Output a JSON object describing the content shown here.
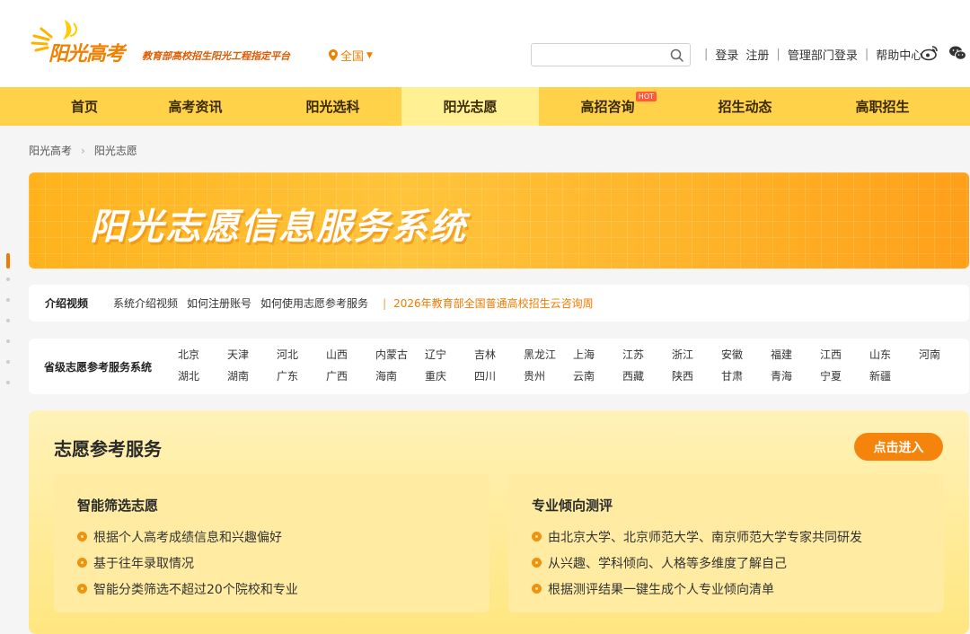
{
  "brand": {
    "logo_main": "阳光高考",
    "logo_sub": "教育部高校招生阳光工程指定平台",
    "accent": "#f08000"
  },
  "location": {
    "label": "全国"
  },
  "search": {
    "placeholder": ""
  },
  "toplinks": {
    "login": "登录",
    "register": "注册",
    "admin_login": "管理部门登录",
    "help": "帮助中心"
  },
  "nav": {
    "items": [
      {
        "label": "首页"
      },
      {
        "label": "高考资讯"
      },
      {
        "label": "阳光选科"
      },
      {
        "label": "阳光志愿"
      },
      {
        "label": "高招咨询"
      },
      {
        "label": "招生动态"
      },
      {
        "label": "高职招生"
      }
    ],
    "hot_badge": "HOT",
    "active": "阳光志愿"
  },
  "breadcrumb": {
    "root": "阳光高考",
    "current": "阳光志愿"
  },
  "banner": {
    "title": "阳光志愿信息服务系统"
  },
  "intro": {
    "label": "介绍视频",
    "links": [
      "系统介绍视频",
      "如何注册账号",
      "如何使用志愿参考服务"
    ],
    "highlight": "2026年教育部全国普通高校招生云咨询周"
  },
  "provinces": {
    "label": "省级志愿参考服务系统",
    "row1": [
      "北京",
      "天津",
      "河北",
      "山西",
      "内蒙古",
      "辽宁",
      "吉林",
      "黑龙江",
      "上海",
      "江苏",
      "浙江",
      "安徽",
      "福建",
      "江西",
      "山东",
      "河南"
    ],
    "row2": [
      "湖北",
      "湖南",
      "广东",
      "广西",
      "海南",
      "重庆",
      "四川",
      "贵州",
      "云南",
      "西藏",
      "陕西",
      "甘肃",
      "青海",
      "宁夏",
      "新疆"
    ]
  },
  "service": {
    "title": "志愿参考服务",
    "enter_label": "点击进入",
    "cards": [
      {
        "title": "智能筛选志愿",
        "items": [
          "根据个人高考成绩信息和兴趣偏好",
          "基于往年录取情况",
          "智能分类筛选不超过20个院校和专业"
        ]
      },
      {
        "title": "专业倾向测评",
        "items": [
          "由北京大学、北京师范大学、南京师范大学专家共同研发",
          "从兴趣、学科倾向、人格等多维度了解自己",
          "根据测评结果一键生成个人专业倾向清单"
        ]
      }
    ]
  }
}
